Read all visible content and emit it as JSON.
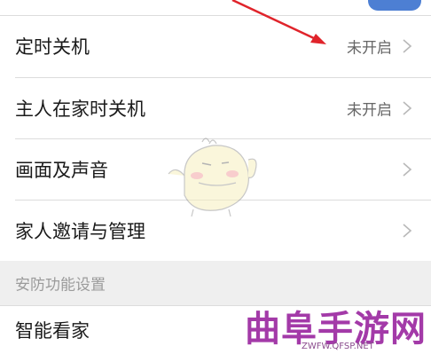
{
  "settings": {
    "items": [
      {
        "label": "定时关机",
        "value": "未开启"
      },
      {
        "label": "主人在家时关机",
        "value": "未开启"
      },
      {
        "label": "画面及声音",
        "value": ""
      },
      {
        "label": "家人邀请与管理",
        "value": ""
      }
    ],
    "section_title": "安防功能设置",
    "section_items": [
      {
        "label": "智能看家"
      }
    ]
  },
  "watermark": {
    "brand": "曲阜手游网",
    "url": "ZWFW.QFSP.NET"
  },
  "colors": {
    "accent_arrow": "#e0242b",
    "section_bg": "#efefef",
    "watermark": "#a33aa8"
  },
  "icons": [
    "chevron-right-icon",
    "mascot-watermark-icon"
  ]
}
